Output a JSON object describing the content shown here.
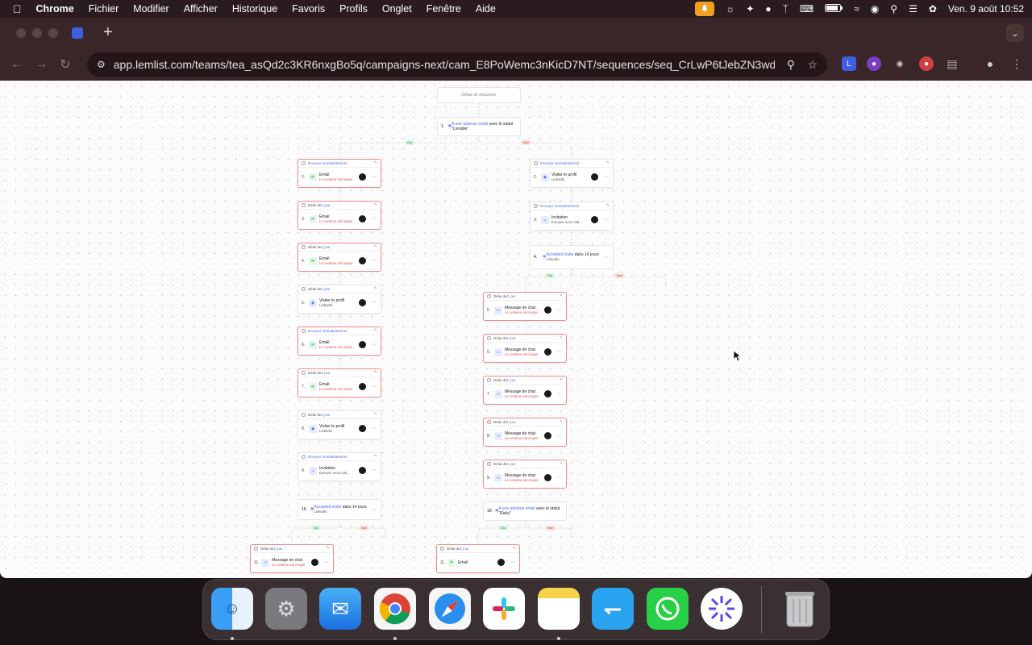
{
  "menubar": {
    "apple": "",
    "items": [
      "Chrome",
      "Fichier",
      "Modifier",
      "Afficher",
      "Historique",
      "Favoris",
      "Profils",
      "Onglet",
      "Fenêtre",
      "Aide"
    ],
    "datetime": "Ven. 9 août  10:52"
  },
  "toolbar": {
    "url": "app.lemlist.com/teams/tea_asQd2c3KR6nxgBo5q/campaigns-next/cam_E8PoWemc3nKicD7NT/sequences/seq_CrLwP6tJebZN3wdYg/edit"
  },
  "canvas": {
    "start_label": "Début de séquence",
    "root_condition": {
      "num": "1.",
      "pre": "A une adresse email",
      "post": " avec le statut \"Livrable\""
    },
    "oui": "Oui",
    "non": "Non",
    "left_steps": [
      {
        "num": "2.",
        "hdr_pre": "",
        "hdr_hl": "Envoyer immédiatement",
        "title": "Email",
        "sub": "Le contenu est requis",
        "type": "email",
        "err": true
      },
      {
        "num": "3.",
        "hdr_pre": "Délai de ",
        "hdr_hl": "1 jour",
        "title": "Email",
        "sub": "Le contenu est requis",
        "type": "email",
        "err": true
      },
      {
        "num": "4.",
        "hdr_pre": "Délai de ",
        "hdr_hl": "1 jour",
        "title": "Email",
        "sub": "Le contenu est requis",
        "type": "email",
        "err": true
      },
      {
        "num": "5.",
        "hdr_pre": "Délai de ",
        "hdr_hl": "1 jour",
        "title": "Visiter le profil",
        "sub": "LinkedIn",
        "type": "visit",
        "err": false
      },
      {
        "num": "6.",
        "hdr_pre": "",
        "hdr_hl": "Envoyer immédiatement",
        "title": "Email",
        "sub": "Le contenu est requis",
        "type": "email",
        "err": true
      },
      {
        "num": "7.",
        "hdr_pre": "Délai de ",
        "hdr_hl": "1 jour",
        "title": "Email",
        "sub": "Le contenu est requis",
        "type": "email",
        "err": true
      },
      {
        "num": "8.",
        "hdr_pre": "Délai de ",
        "hdr_hl": "1 jour",
        "title": "Visiter le profil",
        "sub": "LinkedIn",
        "type": "visit",
        "err": false
      },
      {
        "num": "9.",
        "hdr_pre": "",
        "hdr_hl": "Envoyer immédiatement",
        "title": "Invitation",
        "sub": "Envoyer vers Link...",
        "type": "invite",
        "err": false
      }
    ],
    "left_condition": {
      "num": "10.",
      "pre": "Accepted invite",
      "post": " dans 14 jours",
      "sub": "LinkedIn"
    },
    "left_bottom": [
      {
        "num": "11.",
        "hdr_pre": "Délai de ",
        "hdr_hl": "1 jour",
        "title": "Message de chat",
        "sub": "Le contenu est requis",
        "type": "chat",
        "err": true
      },
      {
        "num": "11.",
        "hdr_pre": "Délai de ",
        "hdr_hl": "1 jour",
        "title": "Email",
        "sub": "",
        "type": "email",
        "err": true
      }
    ],
    "right_steps": [
      {
        "num": "2.",
        "hdr_pre": "",
        "hdr_hl": "Envoyer immédiatement",
        "title": "Visiter le profil",
        "sub": "LinkedIn",
        "type": "visit",
        "err": false
      },
      {
        "num": "3.",
        "hdr_pre": "",
        "hdr_hl": "Envoyer immédiatement",
        "title": "Invitation",
        "sub": "Envoyer vers Link...",
        "type": "invite",
        "err": false
      }
    ],
    "right_condition": {
      "num": "4.",
      "pre": "Accepted invite",
      "post": " dans 14 jours",
      "sub": "LinkedIn"
    },
    "mid_steps": [
      {
        "num": "5.",
        "hdr_pre": "Délai de ",
        "hdr_hl": "1 jour",
        "title": "Message de chat",
        "sub": "Le contenu est requis",
        "type": "chat",
        "err": true
      },
      {
        "num": "6.",
        "hdr_pre": "Délai de ",
        "hdr_hl": "1 jour",
        "title": "Message de chat",
        "sub": "Le contenu est requis",
        "type": "chat",
        "err": true
      },
      {
        "num": "7.",
        "hdr_pre": "Délai de ",
        "hdr_hl": "1 jour",
        "title": "Message de chat",
        "sub": "Le contenu est requis",
        "type": "chat",
        "err": true
      },
      {
        "num": "8.",
        "hdr_pre": "Délai de ",
        "hdr_hl": "1 jour",
        "title": "Message de chat",
        "sub": "Le contenu est requis",
        "type": "chat",
        "err": true
      },
      {
        "num": "9.",
        "hdr_pre": "Délai de ",
        "hdr_hl": "1 jour",
        "title": "Message de chat",
        "sub": "Le contenu est requis",
        "type": "chat",
        "err": true
      }
    ],
    "mid_condition": {
      "num": "10.",
      "pre": "A une adresse email",
      "post": " avec le statut \"Risky\""
    }
  },
  "dock": [
    "finder-icon",
    "system-settings-icon",
    "mail-icon",
    "chrome-icon",
    "safari-icon",
    "slack-icon",
    "notes-icon",
    "lemlist-app-icon",
    "whatsapp-icon",
    "perplexity-icon",
    "trash-icon"
  ],
  "colors": {
    "accent": "#4a6cf0",
    "error": "#e04848",
    "success": "#1a8a3a"
  }
}
